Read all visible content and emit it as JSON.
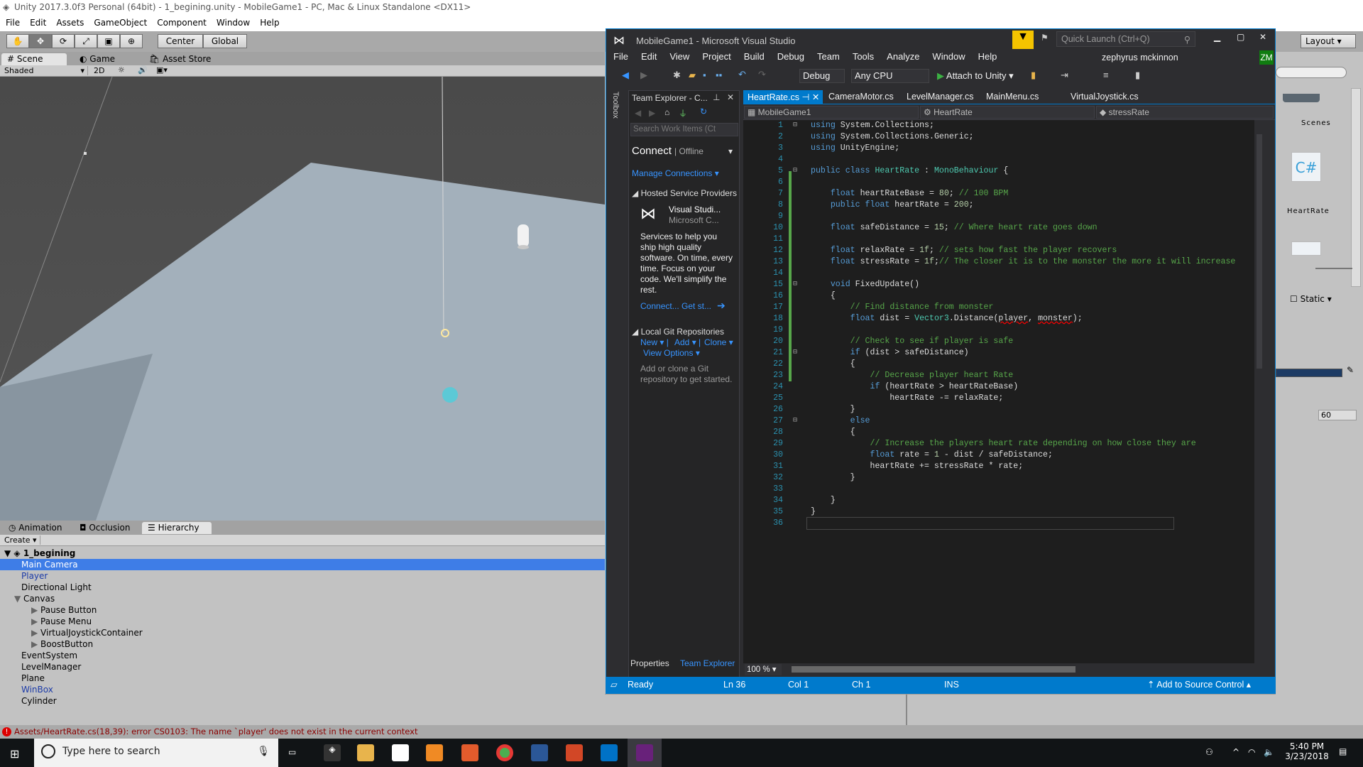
{
  "unity": {
    "title": "Unity 2017.3.0f3 Personal (64bit) - 1_begining.unity - MobileGame1 - PC, Mac & Linux Standalone <DX11>",
    "menu": [
      "File",
      "Edit",
      "Assets",
      "GameObject",
      "Component",
      "Window",
      "Help"
    ],
    "toolbar": {
      "center": "Center",
      "global": "Global",
      "layout": "Layout"
    },
    "scene_tabs": [
      "Scene",
      "Game",
      "Asset Store"
    ],
    "scene_bar": {
      "shading": "Shaded",
      "mode2d": "2D"
    },
    "bottom_tabs": [
      "Animation",
      "Occlusion",
      "Hierarchy"
    ],
    "create": "Create",
    "hierarchy": {
      "root": "1_begining",
      "items": [
        {
          "label": "Main Camera",
          "depth": 0,
          "selected": true
        },
        {
          "label": "Player",
          "depth": 0,
          "prefab": true
        },
        {
          "label": "Directional Light",
          "depth": 0
        },
        {
          "label": "Canvas",
          "depth": 0,
          "expanded": true
        },
        {
          "label": "Pause Button",
          "depth": 1,
          "collapsed": true
        },
        {
          "label": "Pause Menu",
          "depth": 1,
          "collapsed": true
        },
        {
          "label": "VirtualJoystickContainer",
          "depth": 1,
          "collapsed": true
        },
        {
          "label": "BoostButton",
          "depth": 1,
          "collapsed": true
        },
        {
          "label": "EventSystem",
          "depth": 0
        },
        {
          "label": "LevelManager",
          "depth": 0
        },
        {
          "label": "Plane",
          "depth": 0
        },
        {
          "label": "WinBox",
          "depth": 0,
          "prefab": true
        },
        {
          "label": "Cylinder",
          "depth": 0
        }
      ]
    },
    "error": "Assets/HeartRate.cs(18,39): error CS0103: The name `player' does not exist in the current context",
    "project": {
      "folder": "Scenes",
      "script": "HeartRate"
    },
    "inspector": {
      "static": "Static",
      "value": "60"
    }
  },
  "vs": {
    "title": "MobileGame1 - Microsoft Visual Studio",
    "quick_launch": "Quick Launch (Ctrl+Q)",
    "menu": [
      "File",
      "Edit",
      "View",
      "Project",
      "Build",
      "Debug",
      "Team",
      "Tools",
      "Analyze",
      "Window",
      "Help"
    ],
    "user": "zephyrus mckinnon",
    "user_initials": "ZM",
    "config": "Debug",
    "platform": "Any CPU",
    "attach": "Attach to Unity",
    "toolbox": "Toolbox",
    "team_explorer": {
      "title": "Team Explorer - C...",
      "search": "Search Work Items (Ct",
      "connect": "Connect",
      "offline": "Offline",
      "manage": "Manage Connections",
      "hosted": "Hosted Service Providers",
      "vs_name": "Visual Studi...",
      "vs_sub": "Microsoft C...",
      "blurb": "Services to help you ship high quality software. On time, every time. Focus on your code. We'll simplify the rest.",
      "connect_link": "Connect...",
      "get_started": "Get st...",
      "local_git": "Local Git Repositories",
      "new": "New",
      "add": "Add",
      "clone": "Clone",
      "view_options": "View Options",
      "git_hint": "Add or clone a Git repository to get started.",
      "tabs": [
        "Properties",
        "Team Explorer"
      ]
    },
    "tabs": [
      "HeartRate.cs",
      "CameraMotor.cs",
      "LevelManager.cs",
      "MainMenu.cs",
      "VirtualJoystick.cs"
    ],
    "nav": [
      "MobileGame1",
      "HeartRate",
      "stressRate"
    ],
    "code": [
      [
        [
          "using",
          "kw"
        ],
        [
          " System.Collections;",
          "tx"
        ]
      ],
      [
        [
          "using",
          "kw"
        ],
        [
          " System.Collections.Generic;",
          "tx"
        ]
      ],
      [
        [
          "using",
          "kw"
        ],
        [
          " UnityEngine;",
          "tx"
        ]
      ],
      [],
      [
        [
          "public class ",
          "kw"
        ],
        [
          "HeartRate",
          "ty"
        ],
        [
          " : ",
          "tx"
        ],
        [
          "MonoBehaviour",
          "ty"
        ],
        [
          " {",
          "tx"
        ]
      ],
      [],
      [
        [
          "    float",
          "kw"
        ],
        [
          " heartRateBase = ",
          "tx"
        ],
        [
          "80",
          "nu"
        ],
        [
          "; ",
          "tx"
        ],
        [
          "// 100 BPM",
          "cm"
        ]
      ],
      [
        [
          "    public float",
          "kw"
        ],
        [
          " heartRate = ",
          "tx"
        ],
        [
          "200",
          "nu"
        ],
        [
          ";",
          "tx"
        ]
      ],
      [],
      [
        [
          "    float",
          "kw"
        ],
        [
          " safeDistance = ",
          "tx"
        ],
        [
          "15",
          "nu"
        ],
        [
          "; ",
          "tx"
        ],
        [
          "// Where heart rate goes down",
          "cm"
        ]
      ],
      [],
      [
        [
          "    float",
          "kw"
        ],
        [
          " relaxRate = ",
          "tx"
        ],
        [
          "1f",
          "nu"
        ],
        [
          "; ",
          "tx"
        ],
        [
          "// sets how fast the player recovers",
          "cm"
        ]
      ],
      [
        [
          "    float",
          "kw"
        ],
        [
          " stressRate = ",
          "tx"
        ],
        [
          "1f",
          "nu"
        ],
        [
          ";",
          "tx"
        ],
        [
          "// The closer it is to the monster the more it will increase",
          "cm"
        ]
      ],
      [],
      [
        [
          "    void",
          "kw"
        ],
        [
          " FixedUpdate()",
          "tx"
        ]
      ],
      [
        [
          "    {",
          "tx"
        ]
      ],
      [
        [
          "        // Find distance from monster",
          "cm"
        ]
      ],
      [
        [
          "        float",
          "kw"
        ],
        [
          " dist = ",
          "tx"
        ],
        [
          "Vector3",
          "ty"
        ],
        [
          ".Distance(",
          "tx"
        ],
        [
          "player",
          "er"
        ],
        [
          ", ",
          "tx"
        ],
        [
          "monster",
          "er"
        ],
        [
          ");",
          "tx"
        ]
      ],
      [],
      [
        [
          "        // Check to see if player is safe",
          "cm"
        ]
      ],
      [
        [
          "        if",
          "kw"
        ],
        [
          " (dist > safeDistance)",
          "tx"
        ]
      ],
      [
        [
          "        {",
          "tx"
        ]
      ],
      [
        [
          "            // Decrease player heart Rate",
          "cm"
        ]
      ],
      [
        [
          "            if",
          "kw"
        ],
        [
          " (heartRate > heartRateBase)",
          "tx"
        ]
      ],
      [
        [
          "                heartRate -= relaxRate;",
          "tx"
        ]
      ],
      [
        [
          "        }",
          "tx"
        ]
      ],
      [
        [
          "        else",
          "kw"
        ]
      ],
      [
        [
          "        {",
          "tx"
        ]
      ],
      [
        [
          "            // Increase the players heart rate depending on how close they are",
          "cm"
        ]
      ],
      [
        [
          "            float",
          "kw"
        ],
        [
          " rate = ",
          "tx"
        ],
        [
          "1",
          "nu"
        ],
        [
          " - dist / safeDistance;",
          "tx"
        ]
      ],
      [
        [
          "            heartRate += stressRate * rate;",
          "tx"
        ]
      ],
      [
        [
          "        }",
          "tx"
        ]
      ],
      [],
      [
        [
          "    }",
          "tx"
        ]
      ],
      [
        [
          "}",
          "tx"
        ]
      ],
      []
    ],
    "zoom": "100 %",
    "status": {
      "ready": "Ready",
      "ln": "Ln 36",
      "col": "Col 1",
      "ch": "Ch 1",
      "ins": "INS",
      "source": "Add to Source Control"
    },
    "colors": {
      "accent": "#007acc",
      "editor_bg": "#1e1e1e"
    }
  },
  "taskbar": {
    "search": "Type here to search",
    "time": "5:40 PM",
    "date": "3/23/2018"
  }
}
